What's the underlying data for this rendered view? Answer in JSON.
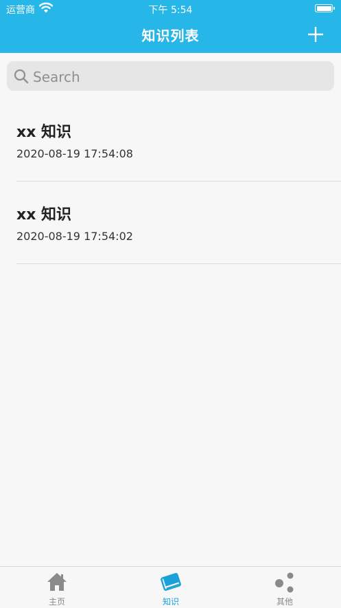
{
  "status_bar": {
    "carrier": "运营商",
    "time": "下午 5:54"
  },
  "nav": {
    "title": "知识列表",
    "add_icon": "plus-icon"
  },
  "search": {
    "placeholder": "Search",
    "value": "",
    "icon": "search-icon"
  },
  "items": [
    {
      "title": "xx 知识",
      "date": "2020-08-19 17:54:08"
    },
    {
      "title": "xx 知识",
      "date": "2020-08-19 17:54:02"
    }
  ],
  "tabs": [
    {
      "label": "主页",
      "icon": "home-icon",
      "active": false
    },
    {
      "label": "知识",
      "icon": "book-icon",
      "active": true
    },
    {
      "label": "其他",
      "icon": "dots-icon",
      "active": false
    }
  ],
  "colors": {
    "accent": "#27b6e8",
    "active_tab": "#1aa1d8",
    "inactive_tab": "#8a8a8a"
  }
}
